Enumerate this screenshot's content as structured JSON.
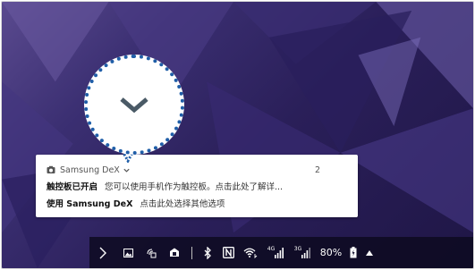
{
  "notification": {
    "app_name": "Samsung DeX",
    "count": "2",
    "line1_title": "触控板已开启",
    "line1_body": "您可以使用手机作为触控板。点击此处了解详...",
    "line2_title": "使用 Samsung DeX",
    "line2_body": "点击此处选择其他选项"
  },
  "callout": {
    "icon": "chevron-down-icon"
  },
  "taskbar": {
    "icons": [
      "chevron-right-icon",
      "gallery-icon",
      "screen-share-icon",
      "dex-icon",
      "bluetooth-icon",
      "nfc-icon",
      "wifi-icon",
      "signal-4g-icon",
      "signal-3g-icon",
      "battery-icon",
      "caret-up-icon"
    ],
    "net1_label": "4G",
    "net2_label": "3G",
    "battery_percent": "80%"
  },
  "colors": {
    "callout_border": "#1f5ea8",
    "chevron": "#4a5a66",
    "taskbar_bg": "#0c0a1e",
    "wallpaper": "#2a1f59"
  }
}
